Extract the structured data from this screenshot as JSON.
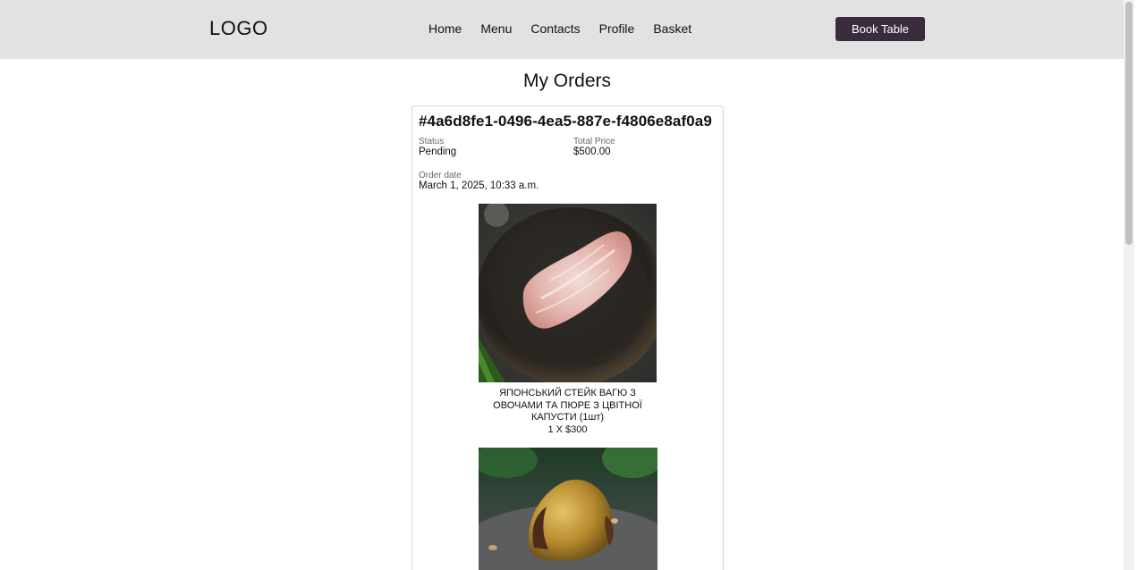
{
  "header": {
    "logo": "LOGO",
    "nav": [
      "Home",
      "Menu",
      "Contacts",
      "Profile",
      "Basket"
    ],
    "book_button": "Book Table"
  },
  "main": {
    "title": "My Orders",
    "order": {
      "id": "#4a6d8fe1-0496-4ea5-887e-f4806e8af0a9",
      "status_label": "Status",
      "status_value": "Pending",
      "total_label": "Total Price",
      "total_value": "$500.00",
      "date_label": "Order date",
      "date_value": "March 1, 2025, 10:33 a.m.",
      "items": [
        {
          "name": "ЯПОНСЬКИЙ СТЕЙК ВАГЮ З ОВОЧАМИ ТА ПЮРЕ З ЦВІТНОЇ КАПУСТИ (1шт)",
          "qty": "1 X $300",
          "image": "wagyu-steak-photo"
        },
        {
          "name": "",
          "qty": "",
          "image": "golden-dessert-photo"
        }
      ]
    }
  }
}
